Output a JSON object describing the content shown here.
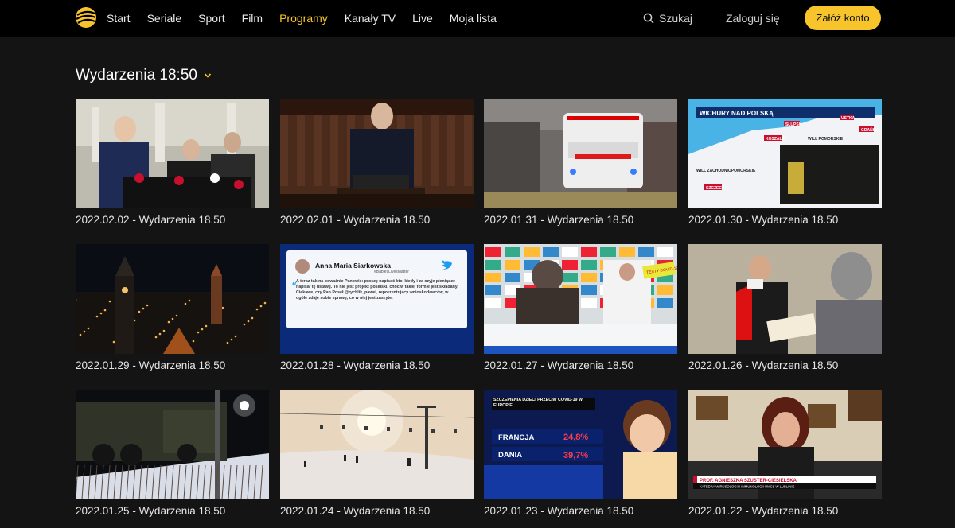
{
  "nav": {
    "items": [
      {
        "label": "Start",
        "active": false
      },
      {
        "label": "Seriale",
        "active": false
      },
      {
        "label": "Sport",
        "active": false
      },
      {
        "label": "Film",
        "active": false
      },
      {
        "label": "Programy",
        "active": true
      },
      {
        "label": "Kanały TV",
        "active": false
      },
      {
        "label": "Live",
        "active": false
      },
      {
        "label": "Moja lista",
        "active": false
      }
    ],
    "search_label": "Szukaj",
    "login_label": "Zaloguj się",
    "signup_label": "Załóż konto"
  },
  "colors": {
    "accent": "#f7c52b",
    "background": "#141414",
    "topbar": "#000000"
  },
  "section": {
    "title": "Wydarzenia 18:50"
  },
  "episodes": [
    {
      "caption": "2022.02.02 - Wydarzenia 18.50",
      "scene": "press-conference"
    },
    {
      "caption": "2022.02.01 - Wydarzenia 18.50",
      "scene": "parliament-speaker"
    },
    {
      "caption": "2022.01.31 - Wydarzenia 18.50",
      "scene": "ambulance"
    },
    {
      "caption": "2022.01.30 - Wydarzenia 18.50",
      "scene": "weather-map",
      "overlay": [
        "WICHURY NAD POLSKĄ",
        "SŁUPSK",
        "USTKA",
        "KOSZALIN",
        "LEBA",
        "GDAŃSK",
        "WILL POMORSKIE",
        "WILL ZACHODNIOPOMORSKIE",
        "SZCZECIN"
      ]
    },
    {
      "caption": "2022.01.29 - Wydarzenia 18.50",
      "scene": "city-night"
    },
    {
      "caption": "2022.01.28 - Wydarzenia 18.50",
      "scene": "tweet",
      "overlay": [
        "Anna Maria Siarkowska",
        "#BabiesLivesMatter",
        "A teraz tak na poważnie Panowie: proszę napisać kto, kiedy i za czyje pieniądze napisał tę ustawę. To nie jest projekt poselski, choć w takiej formie jest składany. Ciekawe, czy Pan Poseł @rychlik_pawel, reprezentujący wnioskodawców, w ogóle zdaje sobie sprawę, co w niej jest zaszyte."
      ]
    },
    {
      "caption": "2022.01.27 - Wydarzenia 18.50",
      "scene": "pharmacy",
      "overlay": [
        "TESTY COVID-19"
      ]
    },
    {
      "caption": "2022.01.26 - Wydarzenia 18.50",
      "scene": "interview"
    },
    {
      "caption": "2022.01.25 - Wydarzenia 18.50",
      "scene": "military-convoy"
    },
    {
      "caption": "2022.01.24 - Wydarzenia 18.50",
      "scene": "ski-slope"
    },
    {
      "caption": "2022.01.23 - Wydarzenia 18.50",
      "scene": "covid-stats",
      "overlay": [
        "SZCZEPIENIA DZIECI PRZECIW COVID-19 W EUROPIE",
        "FRANCJA",
        "24,8%",
        "DANIA",
        "39,7%"
      ]
    },
    {
      "caption": "2022.01.22 - Wydarzenia 18.50",
      "scene": "expert",
      "overlay": [
        "PROF. AGNIESZKA SZUSTER-CIESIELSKA",
        "KATEDRA WIRUSOLOGII I IMMUNOLOGII UMCS W LUBLINIE"
      ]
    }
  ],
  "icons": {
    "logo": "brand-logo-icon",
    "search": "search-icon",
    "chevron": "chevron-down-icon"
  }
}
